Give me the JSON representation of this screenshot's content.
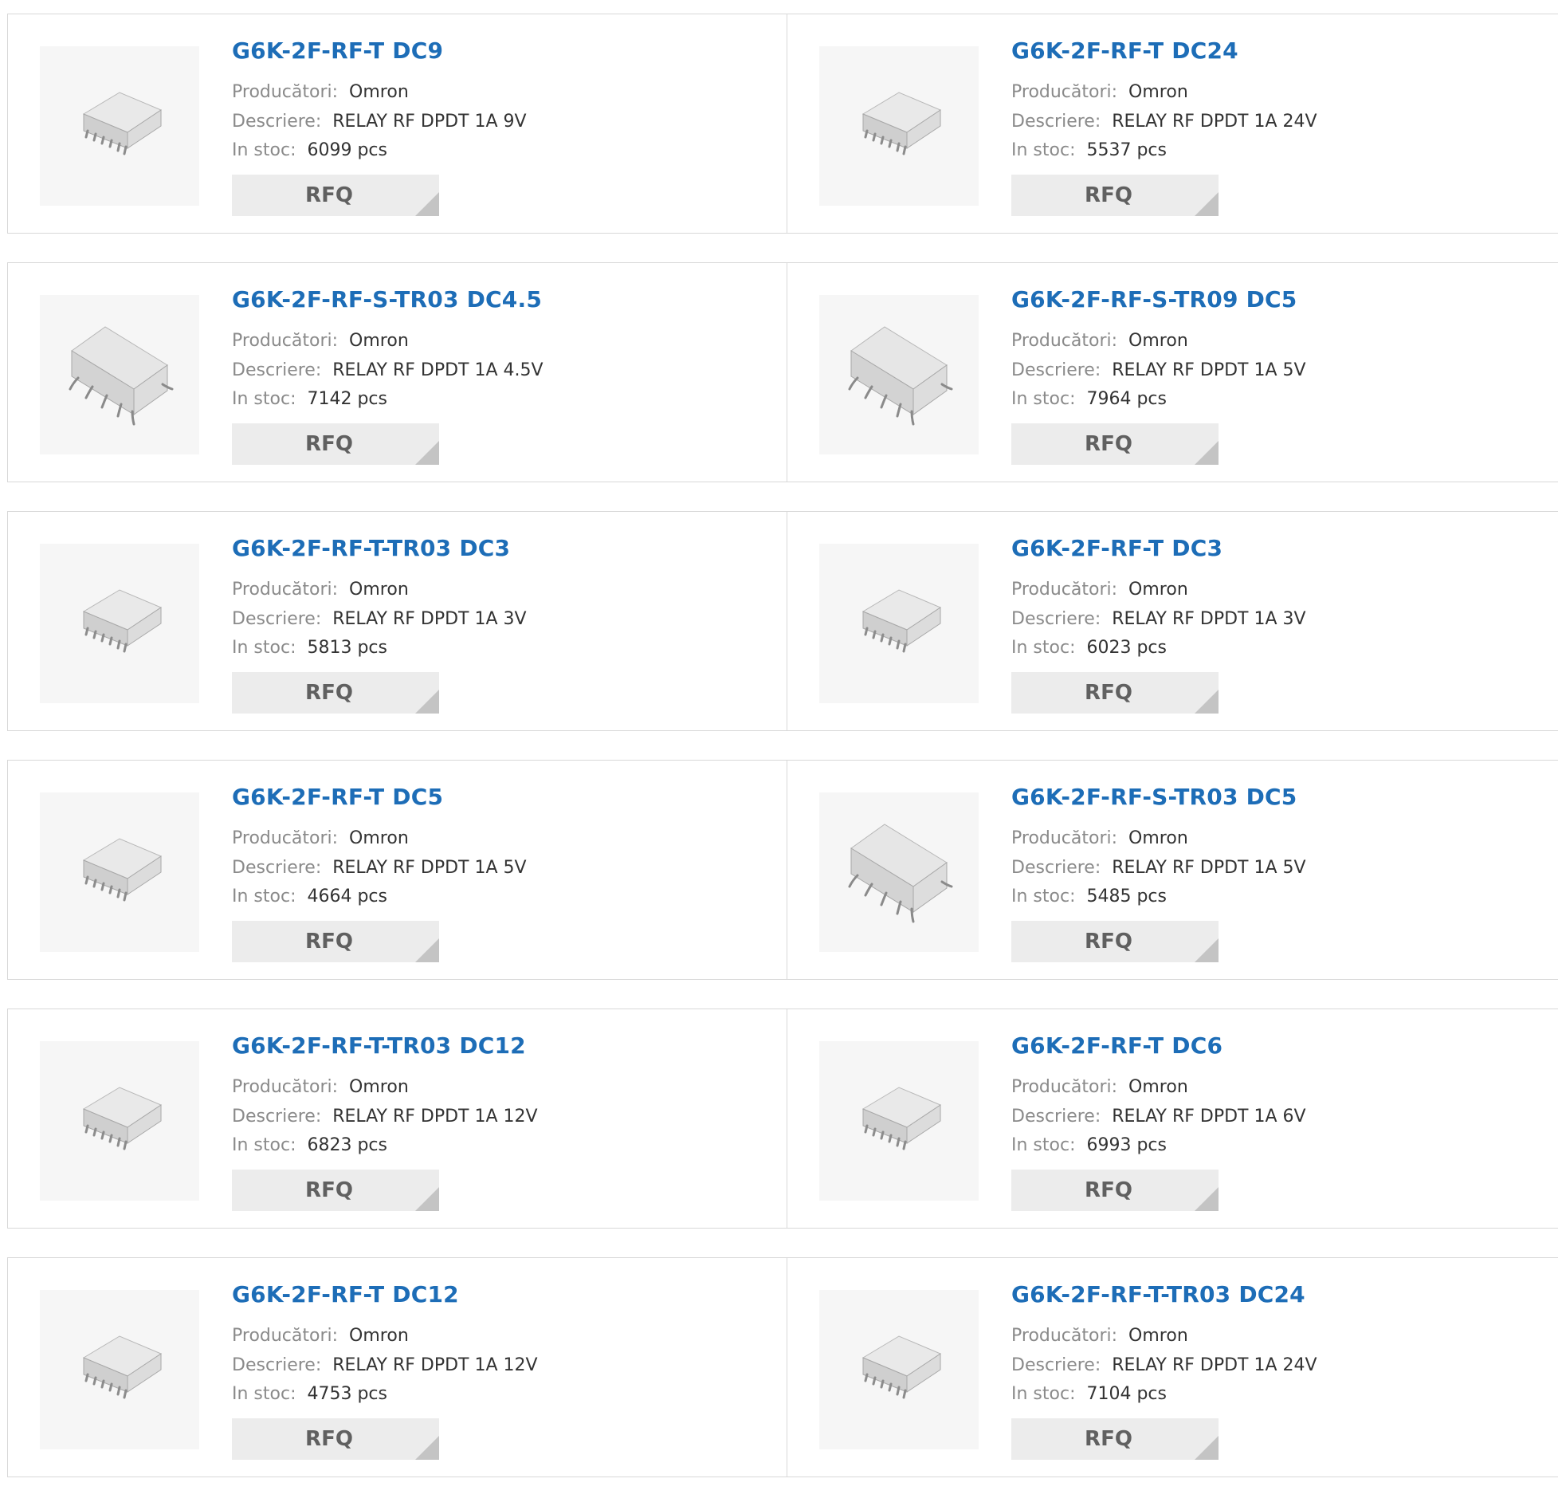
{
  "labels": {
    "manufacturer": "Producători:",
    "description": "Descriere:",
    "stock": "In stoc:",
    "rfq": "RFQ"
  },
  "colors": {
    "title_link": "#1d6db7",
    "label_text": "#8a8a8a",
    "value_text": "#333333",
    "rfq_button": "#ececec",
    "border": "#d8d8d8"
  },
  "products": [
    {
      "name": "G6K-2F-RF-T DC9",
      "manufacturer": "Omron",
      "description": "RELAY RF DPDT 1A 9V",
      "stock": "6099 pcs",
      "image_icon": "relay-flat-icon"
    },
    {
      "name": "G6K-2F-RF-T DC24",
      "manufacturer": "Omron",
      "description": "RELAY RF DPDT 1A 24V",
      "stock": "5537 pcs",
      "image_icon": "relay-flat-icon"
    },
    {
      "name": "G6K-2F-RF-S-TR03 DC4.5",
      "manufacturer": "Omron",
      "description": "RELAY RF DPDT 1A 4.5V",
      "stock": "7142 pcs",
      "image_icon": "relay-smd-icon"
    },
    {
      "name": "G6K-2F-RF-S-TR09 DC5",
      "manufacturer": "Omron",
      "description": "RELAY RF DPDT 1A 5V",
      "stock": "7964 pcs",
      "image_icon": "relay-smd-icon"
    },
    {
      "name": "G6K-2F-RF-T-TR03 DC3",
      "manufacturer": "Omron",
      "description": "RELAY RF DPDT 1A 3V",
      "stock": "5813 pcs",
      "image_icon": "relay-flat-icon"
    },
    {
      "name": "G6K-2F-RF-T DC3",
      "manufacturer": "Omron",
      "description": "RELAY RF DPDT 1A 3V",
      "stock": "6023 pcs",
      "image_icon": "relay-flat-icon"
    },
    {
      "name": "G6K-2F-RF-T DC5",
      "manufacturer": "Omron",
      "description": "RELAY RF DPDT 1A 5V",
      "stock": "4664 pcs",
      "image_icon": "relay-flat-icon"
    },
    {
      "name": "G6K-2F-RF-S-TR03 DC5",
      "manufacturer": "Omron",
      "description": "RELAY RF DPDT 1A 5V",
      "stock": "5485 pcs",
      "image_icon": "relay-smd-icon"
    },
    {
      "name": "G6K-2F-RF-T-TR03 DC12",
      "manufacturer": "Omron",
      "description": "RELAY RF DPDT 1A 12V",
      "stock": "6823 pcs",
      "image_icon": "relay-flat-icon"
    },
    {
      "name": "G6K-2F-RF-T DC6",
      "manufacturer": "Omron",
      "description": "RELAY RF DPDT 1A 6V",
      "stock": "6993 pcs",
      "image_icon": "relay-flat-icon"
    },
    {
      "name": "G6K-2F-RF-T DC12",
      "manufacturer": "Omron",
      "description": "RELAY RF DPDT 1A 12V",
      "stock": "4753 pcs",
      "image_icon": "relay-flat-icon"
    },
    {
      "name": "G6K-2F-RF-T-TR03 DC24",
      "manufacturer": "Omron",
      "description": "RELAY RF DPDT 1A 24V",
      "stock": "7104 pcs",
      "image_icon": "relay-flat-icon"
    }
  ]
}
